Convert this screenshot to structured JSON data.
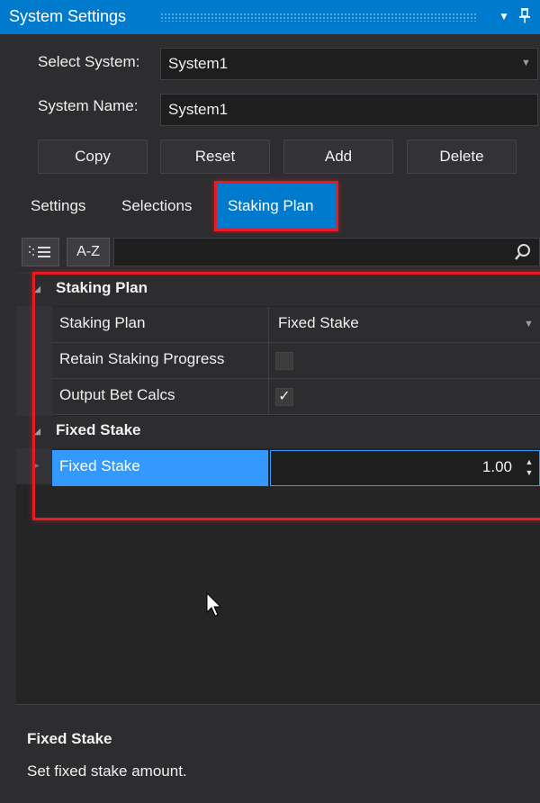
{
  "panel": {
    "title": "System Settings"
  },
  "form": {
    "select_system_label": "Select System:",
    "select_system_value": "System1",
    "system_name_label": "System Name:",
    "system_name_value": "System1"
  },
  "buttons": {
    "copy": "Copy",
    "reset": "Reset",
    "add": "Add",
    "delete": "Delete"
  },
  "tabs": {
    "settings": "Settings",
    "selections": "Selections",
    "staking_plan": "Staking Plan",
    "active": "Staking Plan"
  },
  "toolbar": {
    "sort_alpha": "A-Z",
    "search_placeholder": ""
  },
  "grid": {
    "categories": [
      {
        "name": "Staking Plan",
        "properties": [
          {
            "name": "Staking Plan",
            "value": "Fixed Stake",
            "type": "dropdown"
          },
          {
            "name": "Retain Staking Progress",
            "checked": false,
            "type": "checkbox"
          },
          {
            "name": "Output Bet Calcs",
            "checked": true,
            "type": "checkbox"
          }
        ]
      },
      {
        "name": "Fixed Stake",
        "properties": [
          {
            "name": "Fixed Stake",
            "value": "1.00",
            "type": "numeric",
            "selected": true
          }
        ]
      }
    ]
  },
  "description": {
    "title": "Fixed Stake",
    "text": "Set fixed stake amount."
  },
  "colors": {
    "accent": "#007acc",
    "background": "#2d2d30",
    "highlight": "#e51c23",
    "field_bg": "#1e1e1e"
  },
  "icons": {
    "dropdown": "chevron-down-icon",
    "pin": "pin-icon",
    "search": "search-icon",
    "categorized": "categorized-view-icon",
    "spinner": "spinner-arrows-icon"
  }
}
